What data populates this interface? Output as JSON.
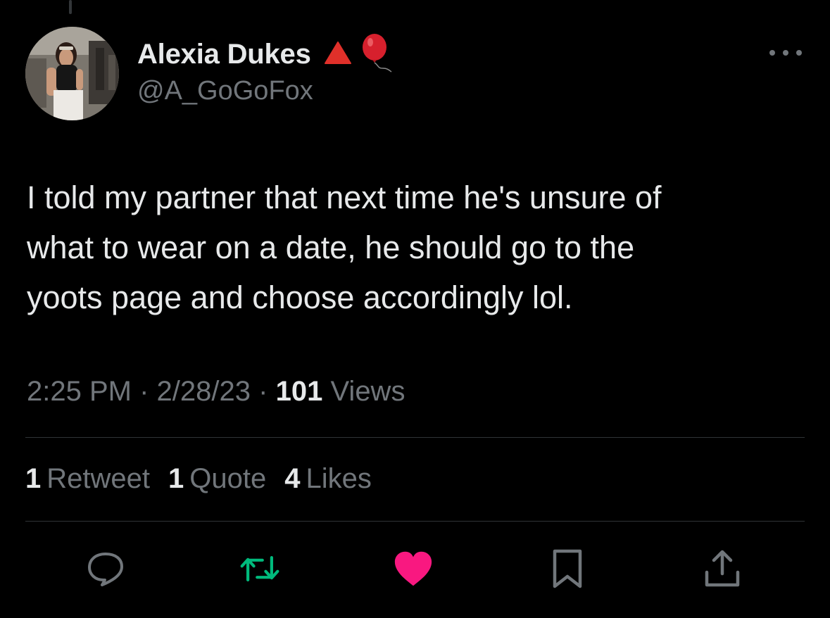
{
  "author": {
    "display_name": "Alexia Dukes",
    "handle": "@A_GoGoFox",
    "badges": [
      "red-triangle-emoji",
      "balloon-emoji"
    ]
  },
  "tweet": {
    "text": "I told my partner that next time he's unsure of\nwhat to wear on a date, he should go to the\nyoots page and choose accordingly lol."
  },
  "meta": {
    "time": "2:25 PM",
    "separator": "·",
    "date": "2/28/23",
    "views_count": "101",
    "views_label": "Views"
  },
  "stats": {
    "retweets_count": "1",
    "retweets_label": "Retweet",
    "quotes_count": "1",
    "quotes_label": "Quote",
    "likes_count": "4",
    "likes_label": "Likes"
  },
  "actions": [
    "reply-icon",
    "retweet-icon",
    "like-icon",
    "bookmark-icon",
    "share-icon"
  ],
  "colors": {
    "background": "#000000",
    "text_primary": "#e7e9ea",
    "text_secondary": "#71767b",
    "divider": "#2f3336",
    "retweet_green": "#00ba7c",
    "like_pink": "#f91880"
  }
}
